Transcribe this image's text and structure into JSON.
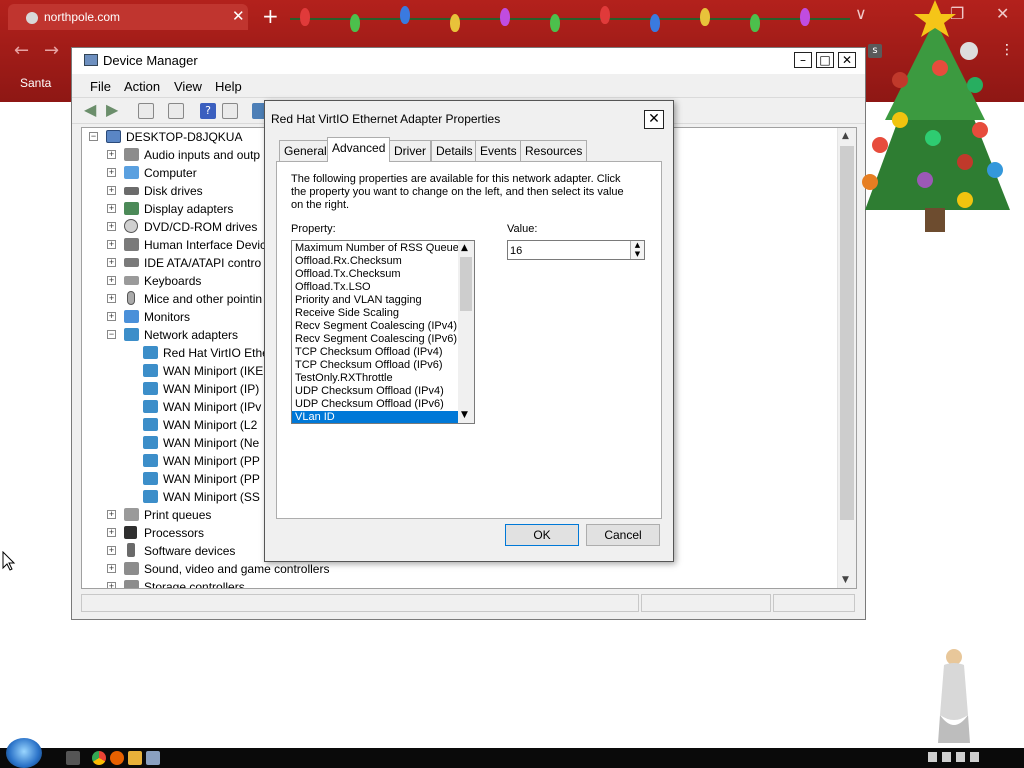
{
  "browser": {
    "tab_title": "northpole.com",
    "tab_close": "✕",
    "new_tab": "+",
    "bookmark": "Santa",
    "profile_initial": "s"
  },
  "device_manager": {
    "title": "Device Manager",
    "menu": [
      "File",
      "Action",
      "View",
      "Help"
    ],
    "tree": {
      "root": "DESKTOP-D8JQKUA",
      "categories": [
        {
          "label": "Audio inputs and outp",
          "icon": "speaker-icon",
          "expanded": false
        },
        {
          "label": "Computer",
          "icon": "computer-icon",
          "expanded": false
        },
        {
          "label": "Disk drives",
          "icon": "disk-drive-icon",
          "expanded": false
        },
        {
          "label": "Display adapters",
          "icon": "display-adapter-icon",
          "expanded": false
        },
        {
          "label": "DVD/CD-ROM drives",
          "icon": "dvd-icon",
          "expanded": false
        },
        {
          "label": "Human Interface Devic",
          "icon": "hid-icon",
          "expanded": false
        },
        {
          "label": "IDE ATA/ATAPI contro",
          "icon": "ide-icon",
          "expanded": false
        },
        {
          "label": "Keyboards",
          "icon": "keyboard-icon",
          "expanded": false
        },
        {
          "label": "Mice and other pointin",
          "icon": "mouse-icon",
          "expanded": false
        },
        {
          "label": "Monitors",
          "icon": "monitor-icon",
          "expanded": false
        },
        {
          "label": "Network adapters",
          "icon": "network-icon",
          "expanded": true
        }
      ],
      "network_children": [
        "Red Hat VirtIO Ethe",
        "WAN Miniport (IKE",
        "WAN Miniport (IP)",
        "WAN Miniport (IPv",
        "WAN Miniport (L2",
        "WAN Miniport (Ne",
        "WAN Miniport (PP",
        "WAN Miniport (PP",
        "WAN Miniport (SS"
      ],
      "categories_after": [
        {
          "label": "Print queues",
          "icon": "printer-icon"
        },
        {
          "label": "Processors",
          "icon": "processor-icon"
        },
        {
          "label": "Software devices",
          "icon": "software-device-icon"
        },
        {
          "label": "Sound, video and game controllers",
          "icon": "speaker-icon"
        },
        {
          "label": "Storage controllers",
          "icon": "storage-icon"
        }
      ]
    }
  },
  "dialog": {
    "title": "Red Hat VirtIO Ethernet Adapter Properties",
    "tabs": [
      "General",
      "Advanced",
      "Driver",
      "Details",
      "Events",
      "Resources"
    ],
    "active_tab": "Advanced",
    "description": "The following properties are available for this network adapter. Click the property you want to change on the left, and then select its value on the right.",
    "property_label": "Property:",
    "value_label": "Value:",
    "properties": [
      "Maximum Number of RSS Queues",
      "Offload.Rx.Checksum",
      "Offload.Tx.Checksum",
      "Offload.Tx.LSO",
      "Priority and VLAN tagging",
      "Receive Side Scaling",
      "Recv Segment Coalescing (IPv4)",
      "Recv Segment Coalescing (IPv6)",
      "TCP Checksum Offload (IPv4)",
      "TCP Checksum Offload (IPv6)",
      "TestOnly.RXThrottle",
      "UDP Checksum Offload (IPv4)",
      "UDP Checksum Offload (IPv6)",
      "VLan ID"
    ],
    "selected_property": "VLan ID",
    "value": "16",
    "ok": "OK",
    "cancel": "Cancel"
  },
  "colors": {
    "browser_red": "#a11c18",
    "selection_blue": "#0078d7"
  }
}
